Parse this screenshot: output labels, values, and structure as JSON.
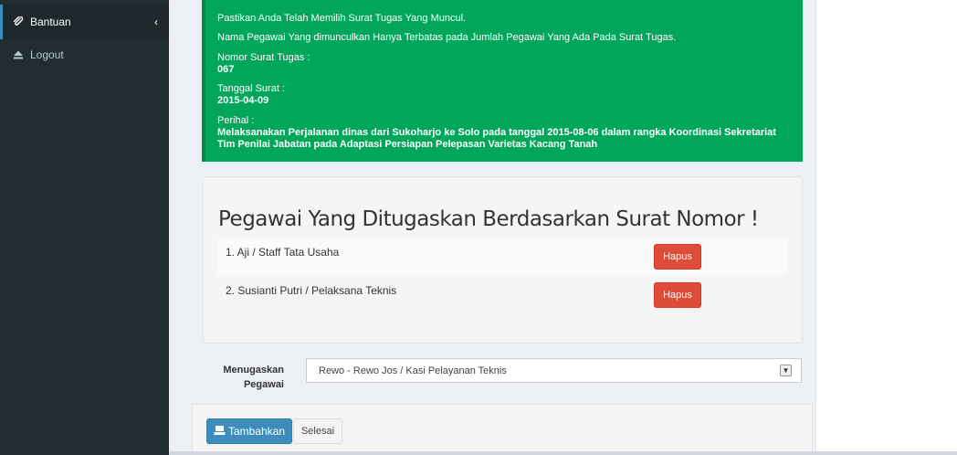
{
  "sidebar": {
    "items": [
      {
        "label": "Bantuan",
        "icon": "paperclip-icon",
        "active": true
      },
      {
        "label": "Logout",
        "icon": "eject-icon",
        "active": false
      }
    ],
    "chevron": "‹"
  },
  "alert": {
    "lines": [
      "Pastikan Anda Telah Memilih Surat Tugas Yang Muncul.",
      "Nama Pegawai Yang dimunculkan Hanya Terbatas pada Jumlah Pegawai Yang Ada Pada Surat Tugas."
    ],
    "nomor_label": "Nomor Surat Tugas :",
    "nomor_value": "067",
    "tanggal_label": "Tanggal Surat :",
    "tanggal_value": "2015-04-09",
    "perihal_label": "Perihal :",
    "perihal_value": "Melaksanakan Perjalanan dinas dari Sukoharjo ke Solo pada tanggal 2015-08-06 dalam rangka Koordinasi Sekretariat Tim Penilai Jabatan pada Adaptasi Persiapan Pelepasan Varietas Kacang Tanah"
  },
  "assigned": {
    "title": "Pegawai Yang Ditugaskan Berdasarkan Surat Nomor !",
    "rows": [
      {
        "text": "1. Aji / Staff Tata Usaha",
        "button": "Hapus"
      },
      {
        "text": "2. Susianti Putri / Pelaksana Teknis",
        "button": "Hapus"
      }
    ]
  },
  "form": {
    "label_line1": "Menugaskan",
    "label_line2": "Pegawai",
    "selected": "Rewo - Rewo Jos / Kasi Pelayanan Teknis"
  },
  "actions": {
    "add_label": "Tambahkan",
    "done_label": "Selesai"
  },
  "colors": {
    "sidebar": "#222d32",
    "success": "#00a65a",
    "danger": "#dd4b39",
    "primary": "#3c8dbc"
  }
}
